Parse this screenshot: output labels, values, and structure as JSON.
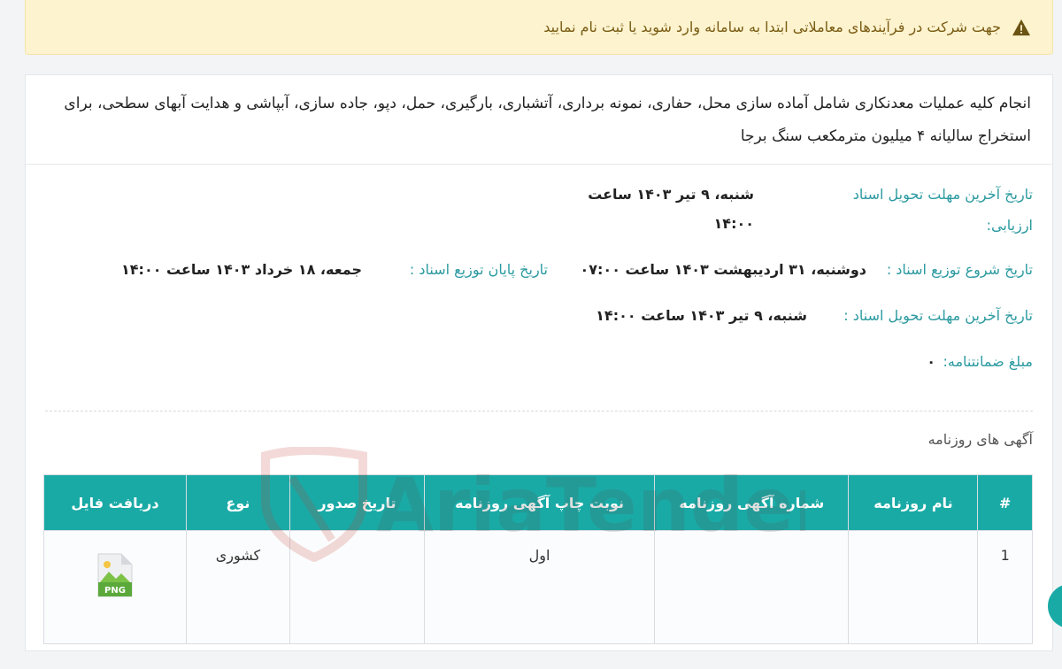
{
  "alert": {
    "text": "جهت شرکت در فرآیندهای معاملاتی ابتدا به سامانه وارد شوید یا ثبت نام نمایید",
    "icon": "warning-icon"
  },
  "description": "انجام کلیه عملیات معدنکاری شامل آماده سازی محل، حفاری، نمونه برداری، آتشباری، بارگیری، حمل، دپو، جاده سازی، آبپاشی و هدایت آبهای سطحی، برای استخراج سالیانه ۴ میلیون مترمکعب سنگ برجا",
  "details": {
    "eval_deadline_label_line1": "تاریخ آخرین مهلت تحویل اسناد",
    "eval_deadline_label_line2": "ارزیابی:",
    "eval_deadline_value_line1": "شنبه، ۹ تیر ۱۴۰۳ ساعت",
    "eval_deadline_value_line2": "۱۴:۰۰",
    "dist_start_label": "تاریخ شروع توزیع اسناد :",
    "dist_start_value": "دوشنبه، ۳۱ اردیبهشت ۱۴۰۳ ساعت ۰۷:۰۰",
    "dist_end_label": "تاریخ پایان توزیع اسناد :",
    "dist_end_value": "جمعه، ۱۸ خرداد ۱۴۰۳ ساعت ۱۴:۰۰",
    "doc_deadline_label": "تاریخ آخرین مهلت تحویل اسناد :",
    "doc_deadline_value": "شنبه، ۹ تیر ۱۴۰۳ ساعت ۱۴:۰۰",
    "guarantee_label": "مبلغ ضمانتنامه:",
    "guarantee_value": "۰"
  },
  "section_title": "آگهی های روزنامه",
  "table": {
    "headers": [
      "#",
      "نام روزنامه",
      "شماره آگهی روزنامه",
      "نوبت چاپ آگهی روزنامه",
      "تاریخ صدور",
      "نوع",
      "دریافت فایل"
    ],
    "rows": [
      {
        "index": "1",
        "name": "",
        "number": "",
        "turn": "اول",
        "date": "",
        "type": "کشوری",
        "file_label": "PNG"
      }
    ]
  },
  "watermark": "AriaTender.neT",
  "colors": {
    "accent": "#1aaaa6",
    "label": "#2b9aa0",
    "alert_bg": "#fdf3cf"
  }
}
